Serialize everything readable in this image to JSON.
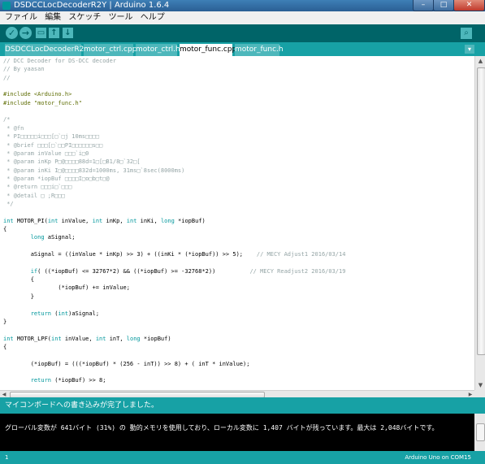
{
  "window": {
    "title": "DSDCCLocDecoderR2Y | Arduino 1.6.4",
    "min": "–",
    "max": "□",
    "close": "✕"
  },
  "menu": [
    "ファイル",
    "編集",
    "スケッチ",
    "ツール",
    "ヘルプ"
  ],
  "toolbar": {
    "verify": "✓",
    "upload": "→",
    "new": "▭",
    "open": "↑",
    "save": "↓",
    "serial_monitor": "⌕"
  },
  "tabs": [
    "DSDCCLocDecoderR2Y",
    "motor_ctrl.cpp",
    "motor_ctrl.h",
    "motor_func.cpp",
    "motor_func.h"
  ],
  "active_tab": 3,
  "tab_menu": "▾",
  "code": [
    "// DCC Decoder for DS-DCC decoder",
    "// By yaasan",
    "//",
    "",
    "#include <Arduino.h>",
    "#include \"motor_func.h\"",
    "",
    "/*",
    " * @fn",
    " * PI□□□□□i□□□[□`□j 10ms□□□□",
    " * @brief □□□[□`□□PI□□□□□□s□□",
    " * @param inValue □□□`i□0",
    " * @param inKp P□@□□□□88d=1□[□B1/8□`32□[",
    " * @param inKi I□@□□□□832d=1000ms, 31ms□`8sec(8000ms)",
    " * @param *iopBuf □□□□I□o□b□t□@",
    " * @return □□□i□`□□□",
    " * @detail □ ;R□□□",
    " */",
    "",
    "int MOTOR_PI(int inValue, int inKp, int inKi, long *iopBuf)",
    "{",
    "        long aSignal;",
    "",
    "        aSignal = ((inValue * inKp) >> 3) + ((inKi * (*iopBuf)) >> 5);    // MECY Adjust1 2016/03/14",
    "",
    "        if( ((*iopBuf) <= 32767*2) && ((*iopBuf) >= -32768*2))          // MECY Readjust2 2016/03/19",
    "        {",
    "                (*iopBuf) += inValue;",
    "        }",
    "",
    "        return (int)aSignal;",
    "}",
    "",
    "int MOTOR_LPF(int inValue, int inT, long *iopBuf)",
    "{",
    "",
    "        (*iopBuf) = (((*iopBuf) * (256 - inT)) >> 8) + ( inT * inValue);",
    "",
    "        return (*iopBuf) >> 8;",
    ""
  ],
  "status": "マイコンボードへの書き込みが完了しました。",
  "console": "グローバル変数が 641バイト (31%) の 動的メモリを使用しており、ローカル変数に 1,407 バイトが残っています。最大は 2,048バイトです。",
  "footer": {
    "line": "1",
    "board": "Arduino Uno on COM15"
  },
  "colors": {
    "toolbar": "#006468",
    "tabbar": "#17a1a5",
    "button": "#4db7bb",
    "comment": "#95a5a6",
    "keyword": "#00979c"
  }
}
